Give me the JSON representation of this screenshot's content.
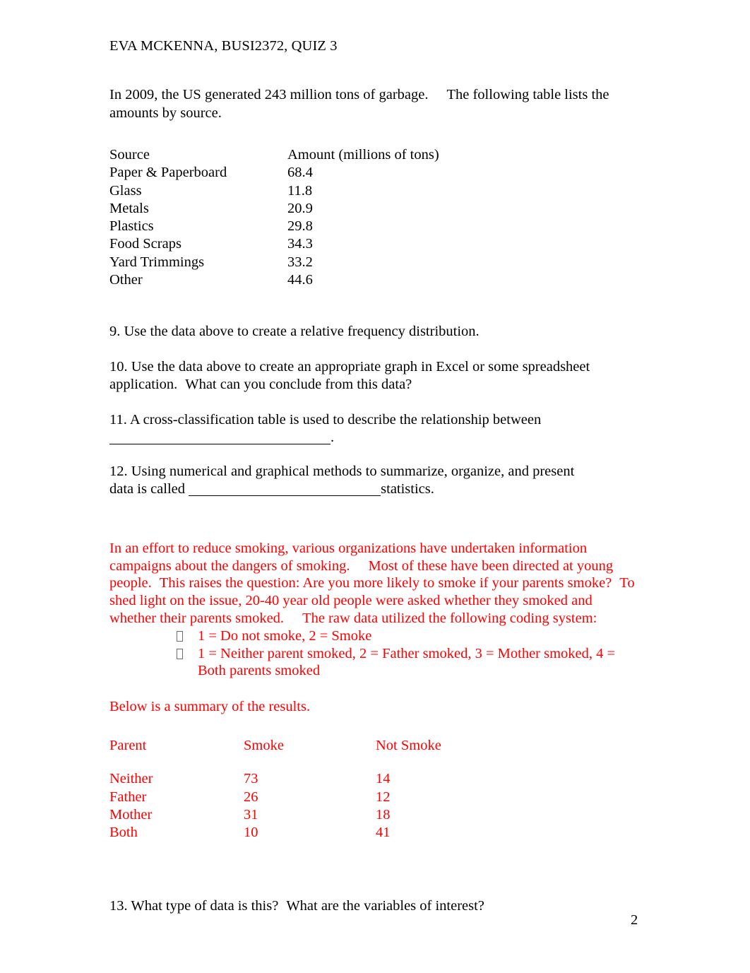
{
  "document": {
    "header": "EVA MCKENNA, BUSI2372, QUIZ 3",
    "page_number": "2"
  },
  "intro": {
    "sentence_1": "In 2009, the US generated 243 million tons of garbage.",
    "sentence_2": "The following table lists the amounts by source."
  },
  "garbage_table": {
    "headers": [
      "Source",
      "Amount (millions of tons)"
    ],
    "rows": [
      {
        "source": "Paper & Paperboard",
        "amount": "68.4"
      },
      {
        "source": "Glass",
        "amount": "11.8"
      },
      {
        "source": "Metals",
        "amount": "20.9"
      },
      {
        "source": "Plastics",
        "amount": "29.8"
      },
      {
        "source": "Food Scraps",
        "amount": "34.3"
      },
      {
        "source": "Yard Trimmings",
        "amount": "33.2"
      },
      {
        "source": "Other",
        "amount": "44.6"
      }
    ]
  },
  "questions": {
    "q9": "9. Use the data above to create a relative frequency distribution.",
    "q10_line1": "10. Use the data above to create an appropriate graph in Excel or some spreadsheet",
    "q10_line2a": "application.",
    "q10_line2b": "What can you conclude from this data?",
    "q11_line1": "11. A cross-classification table is used to describe the relationship between",
    "q11_line2_suffix": ".",
    "q12_line1": "12. Using numerical and graphical methods to summarize, organize, and present",
    "q12_line2_prefix": "data is called ",
    "q12_line2_suffix": "statistics.",
    "q13a": "13. What type of data is this?",
    "q13b": "What are the variables of interest?"
  },
  "smoking_section": {
    "paragraph_part_1": "In an effort to reduce smoking, various organizations have undertaken information campaigns about the dangers of smoking.",
    "paragraph_part_2": "Most of these have been directed at young people.",
    "paragraph_part_3": "This raises the question: Are you more likely to smoke if your parents smoke?",
    "paragraph_part_4": "To shed light on the issue, 20-40 year old people were asked whether they smoked and whether their parents smoked.",
    "paragraph_part_5": "The raw data utilized the following coding system:",
    "coding_bullets": [
      "1 = Do not smoke, 2 = Smoke",
      "1 = Neither parent smoked, 2 = Father smoked, 3 = Mother smoked, 4 = Both parents smoked"
    ],
    "summary_intro": "Below is a summary of the results.",
    "results_table": {
      "headers": [
        "Parent",
        "Smoke",
        "Not Smoke"
      ],
      "rows": [
        {
          "parent": "Neither",
          "smoke": "73",
          "not_smoke": "14"
        },
        {
          "parent": "Father",
          "smoke": "26",
          "not_smoke": "12"
        },
        {
          "parent": "Mother",
          "smoke": "31",
          "not_smoke": "18"
        },
        {
          "parent": "Both",
          "smoke": "10",
          "not_smoke": "41"
        }
      ]
    }
  },
  "colors": {
    "text": "#000000",
    "accent_red": "#ff0000",
    "bullet_glyph": "#6b6b6b"
  }
}
